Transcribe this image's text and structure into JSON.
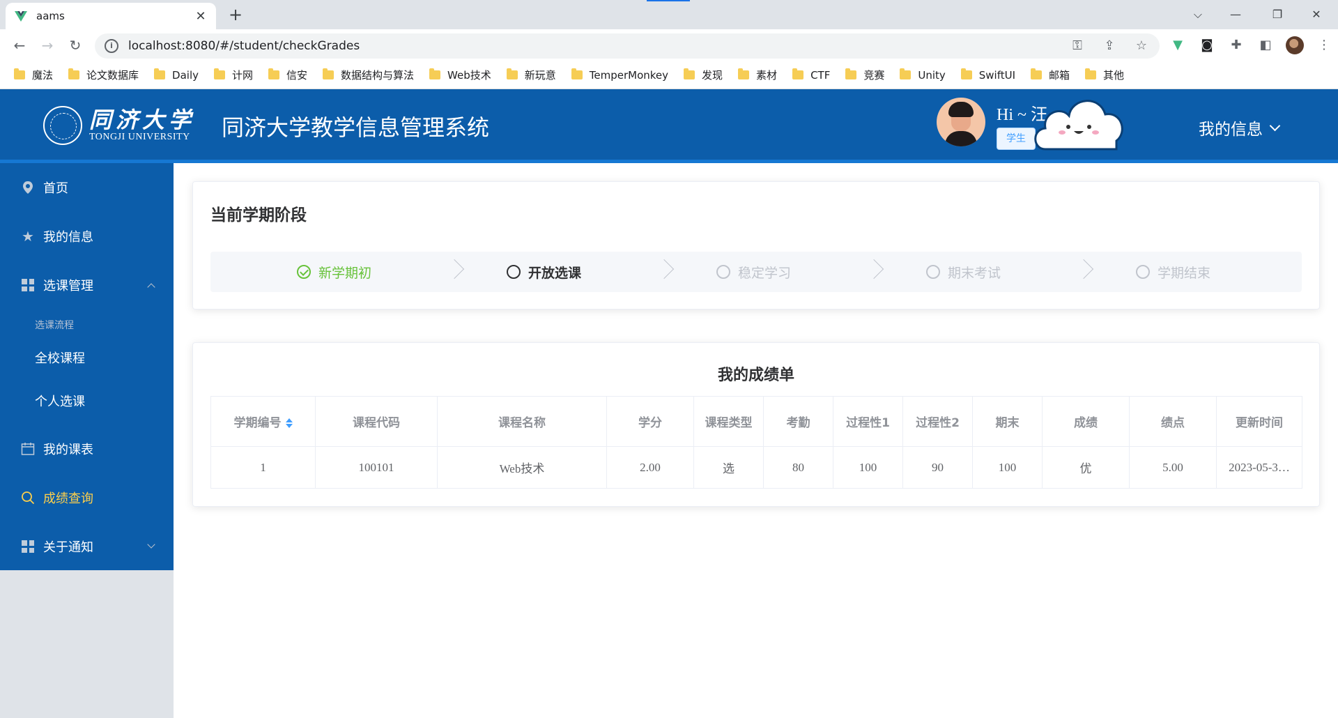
{
  "browser": {
    "tab_title": "aams",
    "url": "localhost:8080/#/student/checkGrades",
    "bookmarks": [
      "魔法",
      "论文数据库",
      "Daily",
      "计网",
      "信安",
      "数据结构与算法",
      "Web技术",
      "新玩意",
      "TemperMonkey",
      "发现",
      "素材",
      "CTF",
      "竞赛",
      "Unity",
      "SwiftUI",
      "邮箱",
      "其他"
    ]
  },
  "header": {
    "logo_cn": "同济大学",
    "logo_en": "TONGJI UNIVERSITY",
    "system_title": "同济大学教学信息管理系统",
    "greeting": "Hi ~ 汪",
    "role_badge": "学生",
    "my_info_menu": "我的信息"
  },
  "sidebar": {
    "home": "首页",
    "my_info": "我的信息",
    "course_selection": "选课管理",
    "course_selection_group": "选课流程",
    "all_courses": "全校课程",
    "personal_selection": "个人选课",
    "my_schedule": "我的课表",
    "grade_query": "成绩查询",
    "notices": "关于通知"
  },
  "semester": {
    "title": "当前学期阶段",
    "steps": [
      {
        "label": "新学期初",
        "status": "success"
      },
      {
        "label": "开放选课",
        "status": "process"
      },
      {
        "label": "稳定学习",
        "status": "wait"
      },
      {
        "label": "期末考试",
        "status": "wait"
      },
      {
        "label": "学期结束",
        "status": "wait"
      }
    ]
  },
  "grades": {
    "title": "我的成绩单",
    "columns": [
      "学期编号",
      "课程代码",
      "课程名称",
      "学分",
      "课程类型",
      "考勤",
      "过程性1",
      "过程性2",
      "期末",
      "成绩",
      "绩点",
      "更新时间"
    ],
    "rows": [
      [
        "1",
        "100101",
        "Web技术",
        "2.00",
        "选",
        "80",
        "100",
        "90",
        "100",
        "优",
        "5.00",
        "2023-05-3…"
      ]
    ]
  },
  "colors": {
    "primary": "#0c5daa",
    "active_menu": "#ffd04b",
    "step_success": "#67c23a",
    "sort_caret": "#409eff"
  }
}
